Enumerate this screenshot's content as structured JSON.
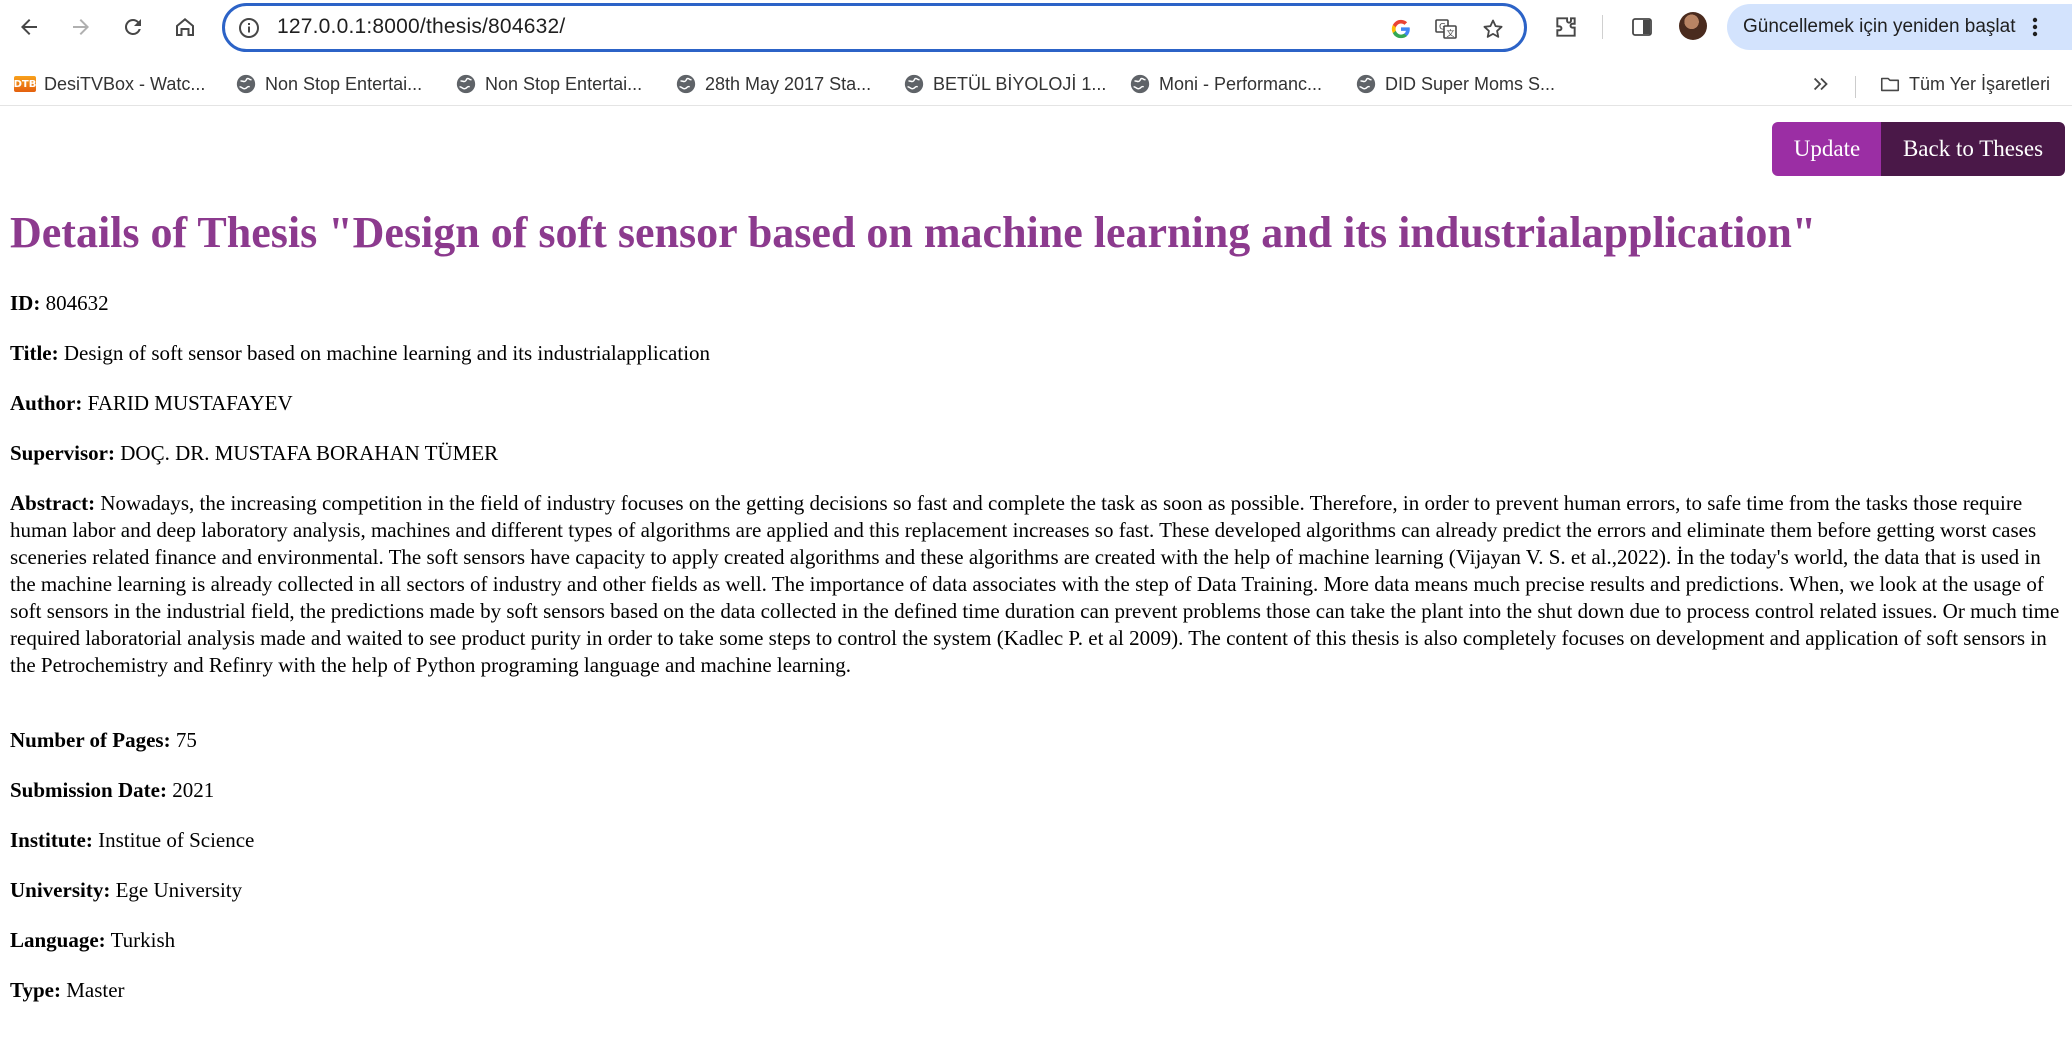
{
  "browser": {
    "url": "127.0.0.1:8000/thesis/804632/",
    "restart_label": "Güncellemek için yeniden başlat",
    "bookmarks": [
      {
        "label": "DesiTVBox - Watc...",
        "icon": "dtb-favicon",
        "icon_text": "DTB"
      },
      {
        "label": "Non Stop Entertai...",
        "icon": "globe-icon"
      },
      {
        "label": "Non Stop Entertai...",
        "icon": "globe-icon"
      },
      {
        "label": "28th May 2017 Sta...",
        "icon": "globe-icon"
      },
      {
        "label": "BETÜL BİYOLOJİ 1...",
        "icon": "globe-icon"
      },
      {
        "label": "Moni - Performanc...",
        "icon": "globe-icon"
      },
      {
        "label": "DID Super Moms S...",
        "icon": "globe-icon"
      }
    ],
    "all_bookmarks_label": "Tüm Yer İşaretleri",
    "colors": {
      "omnibox_border": "#2c63c7",
      "restart_bg": "#d3e3fd"
    }
  },
  "actions": {
    "update_label": "Update",
    "back_label": "Back to Theses",
    "update_color": "#9b2ea4",
    "back_color": "#4a1848"
  },
  "page": {
    "title": "Details of Thesis \"Design of soft sensor based on machine learning and its industrialapplication\"",
    "title_color": "#8c3a8e"
  },
  "thesis": {
    "id": {
      "label": "ID:",
      "value": "804632"
    },
    "title": {
      "label": "Title:",
      "value": "Design of soft sensor based on machine learning and its industrialapplication"
    },
    "author": {
      "label": "Author:",
      "value": "FARID MUSTAFAYEV"
    },
    "supervisor": {
      "label": "Supervisor:",
      "value": "DOÇ. DR. MUSTAFA BORAHAN TÜMER"
    },
    "abstract": {
      "label": "Abstract:",
      "value": "Nowadays, the increasing competition in the field of industry focuses on the getting decisions so fast and complete the task as soon as possible. Therefore, in order to prevent human errors, to safe time from the tasks those require human labor and deep laboratory analysis, machines and different types of algorithms are applied and this replacement increases so fast. These developed algorithms can already predict the errors and eliminate them before getting worst cases sceneries related finance and environmental. The soft sensors have capacity to apply created algorithms and these algorithms are created with the help of machine learning (Vijayan V. S. et al.,2022). İn the today's world, the data that is used in the machine learning is already collected in all sectors of industry and other fields as well. The importance of data associates with the step of Data Training. More data means much precise results and predictions. When, we look at the usage of soft sensors in the industrial field, the predictions made by soft sensors based on the data collected in the defined time duration can prevent problems those can take the plant into the shut down due to process control related issues. Or much time required laboratorial analysis made and waited to see product purity in order to take some steps to control the system (Kadlec P. et al 2009). The content of this thesis is also completely focuses on development and application of soft sensors in the Petrochemistry and Refinry with the help of Python programing language and machine learning."
    },
    "pages": {
      "label": "Number of Pages:",
      "value": "75"
    },
    "submission_date": {
      "label": "Submission Date:",
      "value": "2021"
    },
    "institute": {
      "label": "Institute:",
      "value": "Institue of Science"
    },
    "university": {
      "label": "University:",
      "value": "Ege University"
    },
    "language": {
      "label": "Language:",
      "value": "Turkish"
    },
    "type": {
      "label": "Type:",
      "value": "Master"
    }
  }
}
